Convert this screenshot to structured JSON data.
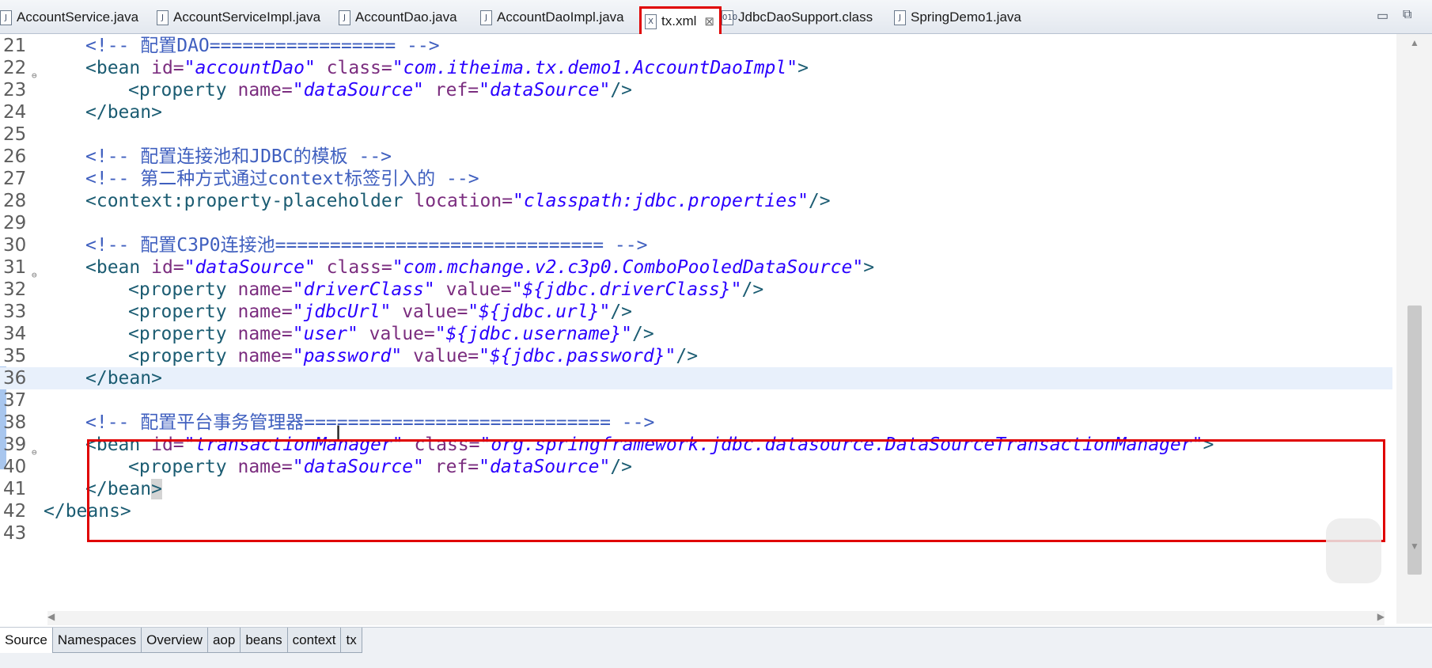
{
  "tabs": [
    {
      "label": "AccountService.java",
      "type": "J"
    },
    {
      "label": "AccountServiceImpl.java",
      "type": "J"
    },
    {
      "label": "AccountDao.java",
      "type": "J"
    },
    {
      "label": "AccountDaoImpl.java",
      "type": "J"
    },
    {
      "label": "tx.xml",
      "type": "X",
      "active": true
    },
    {
      "label": "JdbcDaoSupport.class",
      "type": "010"
    },
    {
      "label": "SpringDemo1.java",
      "type": "J"
    }
  ],
  "window_controls": {
    "minimize": "▭",
    "restore": "▭"
  },
  "editor": {
    "lines": [
      {
        "n": "21",
        "parts": [
          [
            "com",
            "<!-- 配置DAO================= -->"
          ]
        ]
      },
      {
        "n": "22",
        "fold": true,
        "parts": [
          [
            "tag",
            "<bean "
          ],
          [
            "att",
            "id="
          ],
          [
            "val",
            "\"accountDao\""
          ],
          [
            "att",
            " class="
          ],
          [
            "val",
            "\"com.itheima.tx.demo1.AccountDaoImpl\""
          ],
          [
            "tag",
            ">"
          ]
        ]
      },
      {
        "n": "23",
        "indent": 1,
        "parts": [
          [
            "tag",
            "<property "
          ],
          [
            "att",
            "name="
          ],
          [
            "val",
            "\"dataSource\""
          ],
          [
            "att",
            " ref="
          ],
          [
            "val",
            "\"dataSource\""
          ],
          [
            "tag",
            "/>"
          ]
        ]
      },
      {
        "n": "24",
        "parts": [
          [
            "tag",
            "</bean>"
          ]
        ]
      },
      {
        "n": "25",
        "parts": []
      },
      {
        "n": "26",
        "parts": [
          [
            "com",
            "<!-- 配置连接池和JDBC的模板 -->"
          ]
        ]
      },
      {
        "n": "27",
        "parts": [
          [
            "com",
            "<!-- 第二种方式通过context标签引入的 -->"
          ]
        ]
      },
      {
        "n": "28",
        "parts": [
          [
            "tag",
            "<context:property-placeholder "
          ],
          [
            "att",
            "location="
          ],
          [
            "val",
            "\"classpath:jdbc.properties\""
          ],
          [
            "tag",
            "/>"
          ]
        ]
      },
      {
        "n": "29",
        "parts": []
      },
      {
        "n": "30",
        "parts": [
          [
            "com",
            "<!-- 配置C3P0连接池============================== -->"
          ]
        ]
      },
      {
        "n": "31",
        "fold": true,
        "parts": [
          [
            "tag",
            "<bean "
          ],
          [
            "att",
            "id="
          ],
          [
            "val",
            "\"dataSource\""
          ],
          [
            "att",
            " class="
          ],
          [
            "val",
            "\"com.mchange.v2.c3p0.ComboPooledDataSource\""
          ],
          [
            "tag",
            ">"
          ]
        ]
      },
      {
        "n": "32",
        "indent": 1,
        "parts": [
          [
            "tag",
            "<property "
          ],
          [
            "att",
            "name="
          ],
          [
            "val",
            "\"driverClass\""
          ],
          [
            "att",
            " value="
          ],
          [
            "val",
            "\"${jdbc.driverClass}\""
          ],
          [
            "tag",
            "/>"
          ]
        ]
      },
      {
        "n": "33",
        "indent": 1,
        "parts": [
          [
            "tag",
            "<property "
          ],
          [
            "att",
            "name="
          ],
          [
            "val",
            "\"jdbcUrl\""
          ],
          [
            "att",
            " value="
          ],
          [
            "val",
            "\"${jdbc.url}\""
          ],
          [
            "tag",
            "/>"
          ]
        ]
      },
      {
        "n": "34",
        "indent": 1,
        "parts": [
          [
            "tag",
            "<property "
          ],
          [
            "att",
            "name="
          ],
          [
            "val",
            "\"user\""
          ],
          [
            "att",
            " value="
          ],
          [
            "val",
            "\"${jdbc.username}\""
          ],
          [
            "tag",
            "/>"
          ]
        ]
      },
      {
        "n": "35",
        "indent": 1,
        "parts": [
          [
            "tag",
            "<property "
          ],
          [
            "att",
            "name="
          ],
          [
            "val",
            "\"password\""
          ],
          [
            "att",
            " value="
          ],
          [
            "val",
            "\"${jdbc.password}\""
          ],
          [
            "tag",
            "/>"
          ]
        ]
      },
      {
        "n": "36",
        "current": true,
        "parts": [
          [
            "tag",
            "</bean>"
          ]
        ]
      },
      {
        "n": "37",
        "parts": []
      },
      {
        "n": "38",
        "parts": [
          [
            "com",
            "<!-- 配置平台事务管理器============================ -->"
          ]
        ]
      },
      {
        "n": "39",
        "fold": true,
        "parts": [
          [
            "tag",
            "<bean "
          ],
          [
            "att",
            "id="
          ],
          [
            "val",
            "\"transactionManager\""
          ],
          [
            "att",
            " class="
          ],
          [
            "val",
            "\"org.springframework.jdbc.datasource.DataSourceTransactionManager\""
          ],
          [
            "tag",
            ">"
          ]
        ]
      },
      {
        "n": "40",
        "indent": 1,
        "parts": [
          [
            "tag",
            "<property "
          ],
          [
            "att",
            "name="
          ],
          [
            "val",
            "\"dataSource\""
          ],
          [
            "att",
            " ref="
          ],
          [
            "val",
            "\"dataSource\""
          ],
          [
            "tag",
            "/>"
          ]
        ]
      },
      {
        "n": "41",
        "parts": [
          [
            "tag",
            "</bean"
          ],
          [
            "tagmark",
            ">"
          ]
        ]
      },
      {
        "n": "42",
        "outdent": true,
        "parts": [
          [
            "tag",
            "</beans>"
          ]
        ]
      },
      {
        "n": "43",
        "parts": []
      }
    ]
  },
  "bottom_tabs": [
    "Source",
    "Namespaces",
    "Overview",
    "aop",
    "beans",
    "context",
    "tx"
  ],
  "active_bottom_tab": "Source"
}
